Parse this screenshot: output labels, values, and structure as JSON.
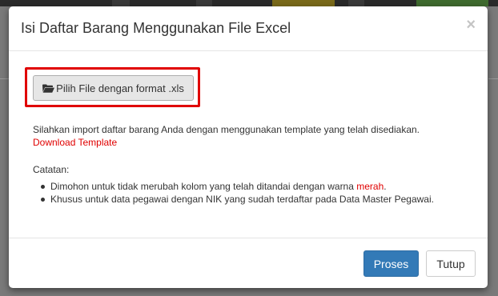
{
  "modal": {
    "title": "Isi Daftar Barang Menggunakan File Excel",
    "close_label": "×",
    "file_button_label": "Pilih File dengan format .xls",
    "description": "Silahkan import daftar barang Anda dengan menggunakan template yang telah disediakan.",
    "download_link": "Download Template",
    "notes_title": "Catatan:",
    "notes": [
      {
        "text_before": "Dimohon untuk tidak merubah kolom yang telah ditandai dengan warna ",
        "highlight": "merah",
        "text_after": "."
      },
      {
        "text": "Khusus untuk data pegawai dengan NIK yang sudah terdaftar pada Data Master Pegawai."
      }
    ],
    "primary_button": "Proses",
    "secondary_button": "Tutup"
  },
  "icons": {
    "file_button_icon": "folder-open-icon",
    "close_icon": "close-icon"
  },
  "colors": {
    "primary": "#337ab7",
    "highlight_border": "#e00000",
    "link": "#e00000"
  }
}
